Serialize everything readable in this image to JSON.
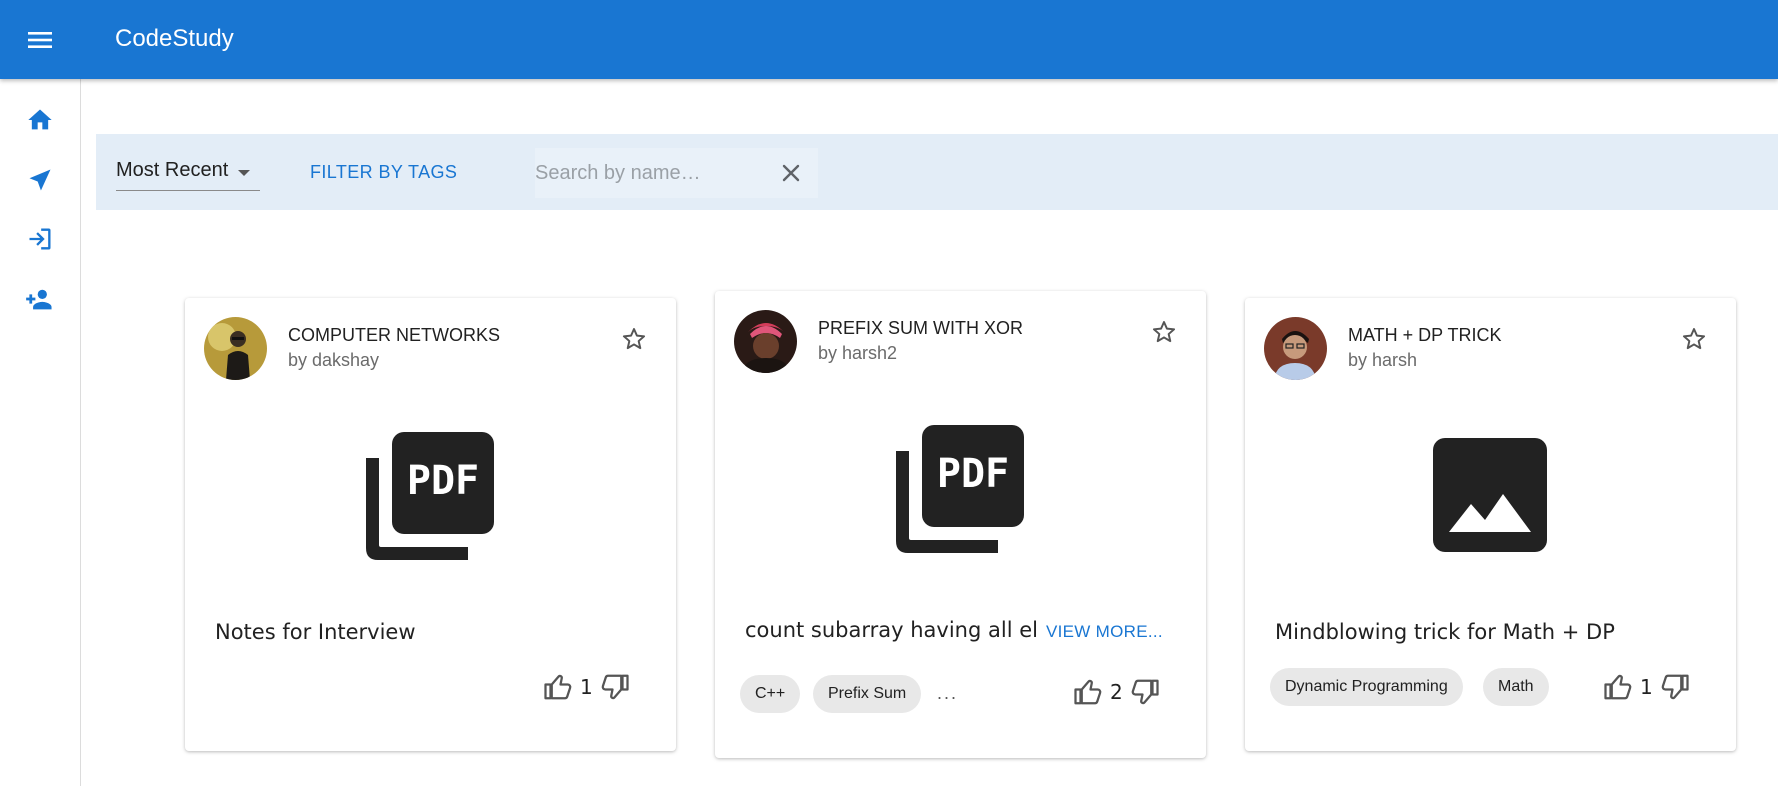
{
  "app": {
    "title": "CodeStudy",
    "menu_icon": "menu-icon"
  },
  "colors": {
    "primary": "#1976d2",
    "filter_bar": "#e3edf7",
    "chip": "#e8e8e8"
  },
  "sidebar": {
    "items": [
      {
        "name": "home",
        "icon": "home-icon"
      },
      {
        "name": "explore",
        "icon": "send-icon"
      },
      {
        "name": "login",
        "icon": "login-icon"
      },
      {
        "name": "signup",
        "icon": "person-add-icon"
      }
    ]
  },
  "filters": {
    "sort_value": "Most Recent",
    "filter_tags_label": "FILTER BY TAGS",
    "search_placeholder": "Search by name…",
    "search_value": ""
  },
  "cards": [
    {
      "title": "COMPUTER NETWORKS",
      "author": "by dakshay",
      "media_icon": "picture-as-pdf-icon",
      "description": "Notes for Interview",
      "tags": [],
      "votes": "1"
    },
    {
      "title": "PREFIX SUM WITH XOR",
      "author": "by harsh2",
      "media_icon": "picture-as-pdf-icon",
      "description": "count subarray having all el",
      "view_more": "VIEW MORE...",
      "tags": [
        "C++",
        "Prefix Sum"
      ],
      "tags_more": "...",
      "votes": "2"
    },
    {
      "title": "MATH + DP TRICK",
      "author": "by harsh",
      "media_icon": "image-icon",
      "description": "Mindblowing trick for Math + DP",
      "tags": [
        "Dynamic Programming",
        "Math"
      ],
      "votes": "1"
    }
  ]
}
